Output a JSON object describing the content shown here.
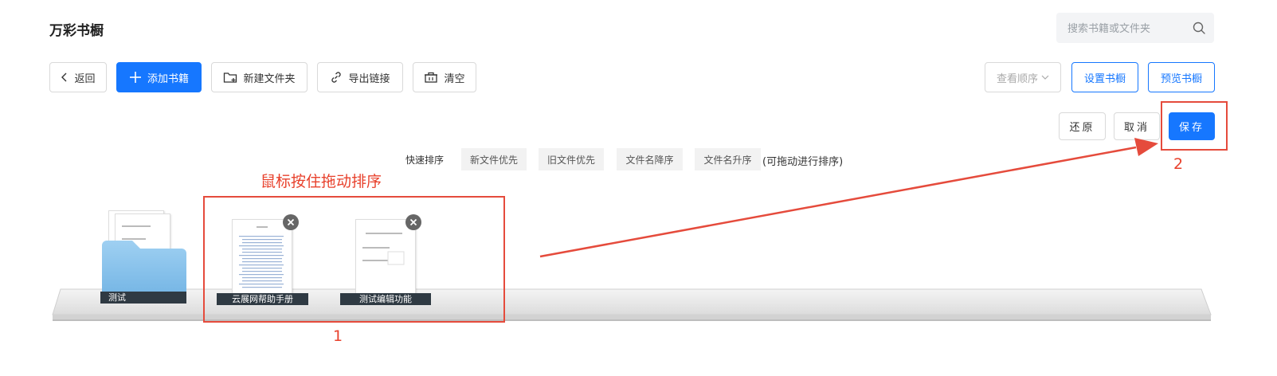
{
  "header": {
    "title": "万彩书橱",
    "search_placeholder": "搜索书籍或文件夹"
  },
  "toolbar": {
    "back": "返回",
    "add_book": "添加书籍",
    "new_folder": "新建文件夹",
    "export_link": "导出链接",
    "clear": "清空",
    "view_order": "查看顺序",
    "set_shelf": "设置书橱",
    "preview_shelf": "预览书橱"
  },
  "actions": {
    "restore": "还原",
    "cancel": "取消",
    "save": "保存"
  },
  "sort": {
    "label": "快速排序",
    "options": [
      "新文件优先",
      "旧文件优先",
      "文件名降序",
      "文件名升序"
    ],
    "hint": "(可拖动进行排序)"
  },
  "annotations": {
    "drag_hint": "鼠标按住拖动排序",
    "step1": "1",
    "step2": "2"
  },
  "shelf": {
    "items": [
      {
        "type": "folder",
        "name": "测试",
        "icon": "folder-icon"
      },
      {
        "type": "book",
        "name": "云展网帮助手册",
        "icon": "document-icon"
      },
      {
        "type": "book",
        "name": "测试编辑功能",
        "icon": "document-icon"
      }
    ]
  },
  "colors": {
    "primary": "#1677ff",
    "annotation_red": "#e8412c",
    "label_bg": "#2f3a43"
  }
}
